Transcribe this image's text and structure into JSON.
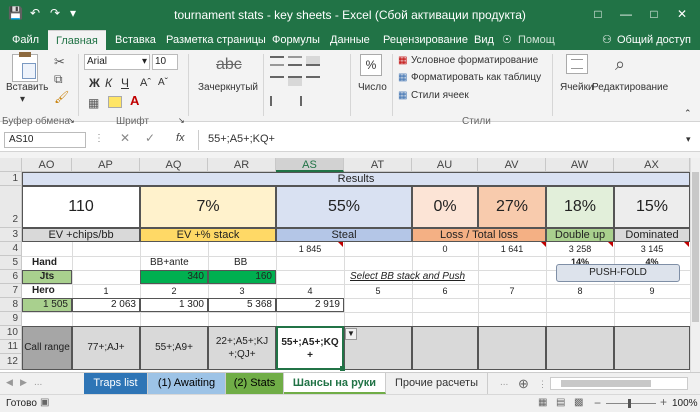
{
  "window": {
    "title": "tournament stats - key sheets - Excel (Сбой активации продукта)"
  },
  "ribbon_tabs": [
    "Файл",
    "Главная",
    "Вставка",
    "Разметка страницы",
    "Формулы",
    "Данные",
    "Рецензирование",
    "Вид"
  ],
  "tell_me": "Помощ",
  "share": "Общий доступ",
  "ribbon": {
    "paste": "Вставить",
    "font_name": "Arial",
    "font_size": "10",
    "bold": "Ж",
    "italic": "К",
    "underline": "Ч",
    "strike": "abc",
    "strike_label": "Зачеркнутый",
    "number": "Число",
    "cond_format": "Условное форматирование",
    "format_table": "Форматировать как таблицу",
    "cell_styles": "Стили ячеек",
    "cells": "Ячейки",
    "editing": "Редактирование",
    "groups": {
      "clipboard": "Буфер обмена",
      "font": "Шрифт",
      "styles": "Стили"
    }
  },
  "formula": {
    "name_box": "AS10",
    "fx": "fx",
    "content": "55+;A5+;KQ+"
  },
  "columns": [
    "AO",
    "AP",
    "AQ",
    "AR",
    "AS",
    "AT",
    "AU",
    "AV",
    "AW",
    "AX"
  ],
  "rows": [
    "1",
    "2",
    "3",
    "4",
    "5",
    "6",
    "7",
    "8",
    "9",
    "10",
    "11",
    "12"
  ],
  "cells": {
    "r1": "Results",
    "r2": [
      "110",
      "7%",
      "55%",
      "0%",
      "27%",
      "18%",
      "15%"
    ],
    "r3": [
      "EV +chips/bb",
      "EV +% stack",
      "Steal",
      "Loss / Total loss",
      "Double up",
      "Dominated"
    ],
    "r4": {
      "as": "1 845",
      "au": "0",
      "av": "1 641",
      "aw": "3 258",
      "ax": "3 145"
    },
    "r5": {
      "ao": "Hand",
      "aq": "BB+ante",
      "ar": "BB",
      "aw": "14%",
      "ax": "4%"
    },
    "r6": {
      "ao": "Jts",
      "aq": "340",
      "ar": "160",
      "hint": "Select BB stack and Push",
      "button": "PUSH-FOLD"
    },
    "r7": [
      "Hero",
      "1",
      "2",
      "3",
      "4",
      "5",
      "6",
      "7",
      "8",
      "9"
    ],
    "r8": [
      "1 505",
      "2 063",
      "1 300",
      "5 368",
      "2 919"
    ],
    "r10": [
      "Call range",
      "77+;AJ+",
      "55+;A9+",
      "22+;A5+;KJ+;QJ+",
      "55+;A5+;KQ+"
    ]
  },
  "sheets": [
    "Traps list",
    "(1) Awaiting",
    "(2) Stats",
    "Шансы на руки",
    "Прочие расчеты"
  ],
  "status": {
    "ready": "Готово",
    "zoom": "100%"
  },
  "colors": {
    "excel_green": "#217346",
    "yellow": "#fff2cc",
    "blue": "#d9e1f2",
    "salmon": "#f8cbad",
    "light_green": "#e2efda",
    "gray": "#d9d9d9",
    "dark_green": "#70ad47",
    "orange": "#f4b084"
  }
}
